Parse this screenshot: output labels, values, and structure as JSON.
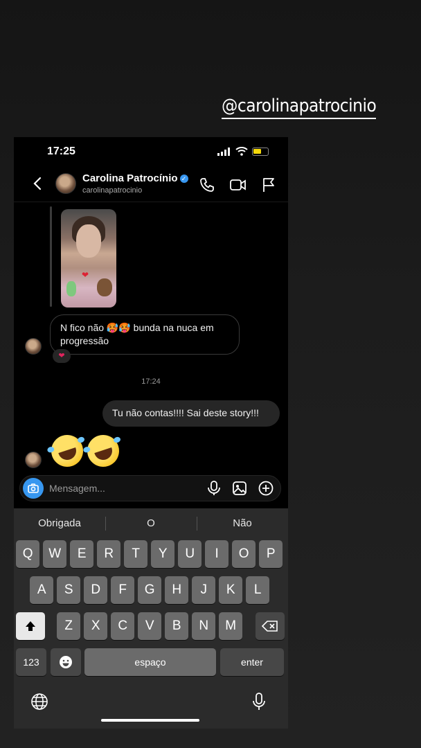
{
  "story_mention": "@carolinapatrocinio",
  "status_bar": {
    "time": "17:25"
  },
  "header": {
    "name": "Carolina Patrocínio",
    "username": "carolinapatrocinio"
  },
  "messages": {
    "received_text": "N fico não 🥵🥵 bunda na nuca em progressão",
    "reaction": "❤",
    "timestamp": "17:24",
    "sent_text": "Tu não contas!!!! Sai deste story!!!"
  },
  "composer": {
    "placeholder": "Mensagem..."
  },
  "keyboard": {
    "suggestions": [
      "Obrigada",
      "O",
      "Não"
    ],
    "row1": [
      "Q",
      "W",
      "E",
      "R",
      "T",
      "Y",
      "U",
      "I",
      "O",
      "P"
    ],
    "row2": [
      "A",
      "S",
      "D",
      "F",
      "G",
      "H",
      "J",
      "K",
      "L"
    ],
    "row3": [
      "Z",
      "X",
      "C",
      "V",
      "B",
      "N",
      "M"
    ],
    "numbers_label": "123",
    "space_label": "espaço",
    "enter_label": "enter"
  },
  "colors": {
    "accent": "#3797f0",
    "sent_bubble": "#262626",
    "battery": "#f5d90a"
  }
}
